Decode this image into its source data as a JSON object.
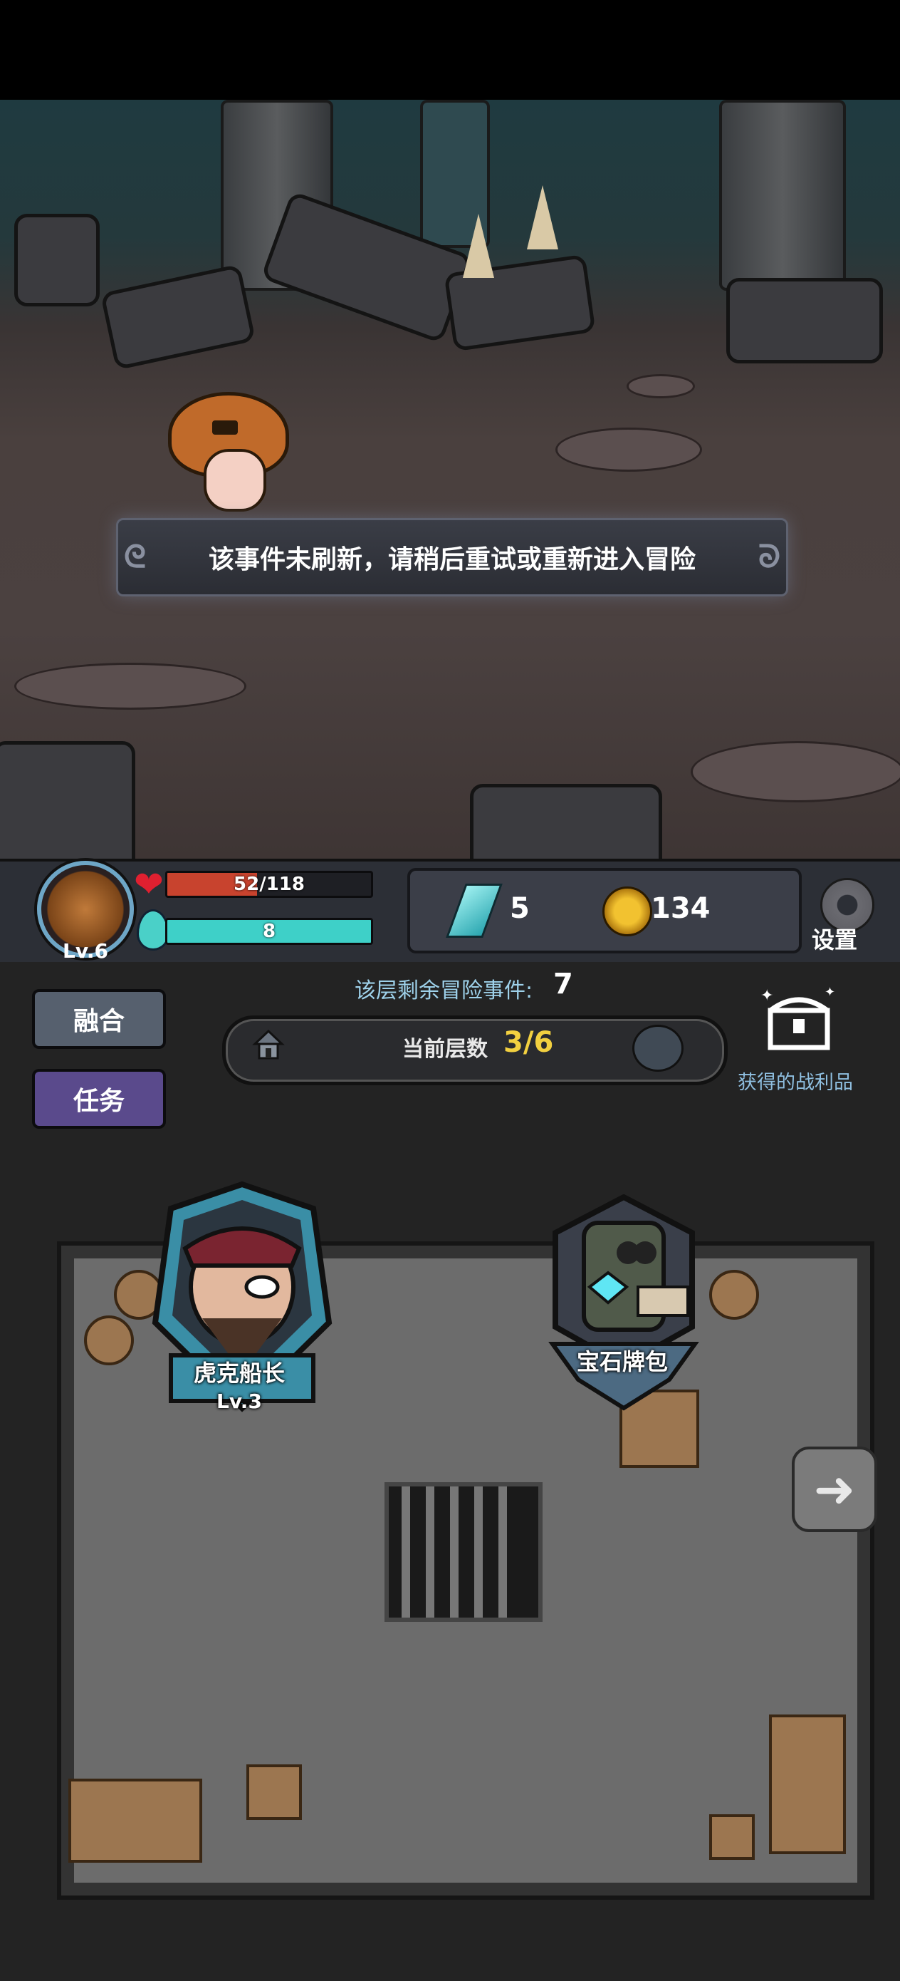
{
  "notice": {
    "text": "该事件未刷新，请稍后重试或重新进入冒险"
  },
  "player": {
    "level_label": "Lv.6",
    "hp_text": "52/118",
    "hp_fraction": 0.44,
    "mp_text": "8",
    "mp_fraction": 1.0
  },
  "resources": {
    "crystal_count": "5",
    "gold_count": "134"
  },
  "settings_label": "设置",
  "side_buttons": {
    "fuse_label": "融合",
    "quest_label": "任务"
  },
  "floor": {
    "remaining_label": "该层剩余冒险事件:",
    "remaining_value": "7",
    "current_label": "当前层数",
    "current_value": "3/6"
  },
  "loot_label": "获得的战利品",
  "characters": [
    {
      "name": "虎克船长",
      "level": "Lv.3",
      "icon": "pirate-captain-portrait"
    },
    {
      "name": "宝石牌包",
      "icon": "gem-card-pack-portrait"
    }
  ],
  "colors": {
    "hp_fill": "#c8432e",
    "mp_fill": "#3ed0c8",
    "fuse_button": "#56606e",
    "quest_button": "#5a4a8c",
    "floor_value": "#f2d040",
    "remaining_label": "#9ed1ea"
  },
  "icons": {
    "heart": "heart-icon",
    "mana": "mana-drop-icon",
    "crystal": "crystal-icon",
    "gold": "gold-coin-icon",
    "settings": "gear-icon",
    "house": "house-icon",
    "boss": "demon-head-icon",
    "loot": "treasure-chest-icon",
    "next": "arrow-right-icon"
  }
}
